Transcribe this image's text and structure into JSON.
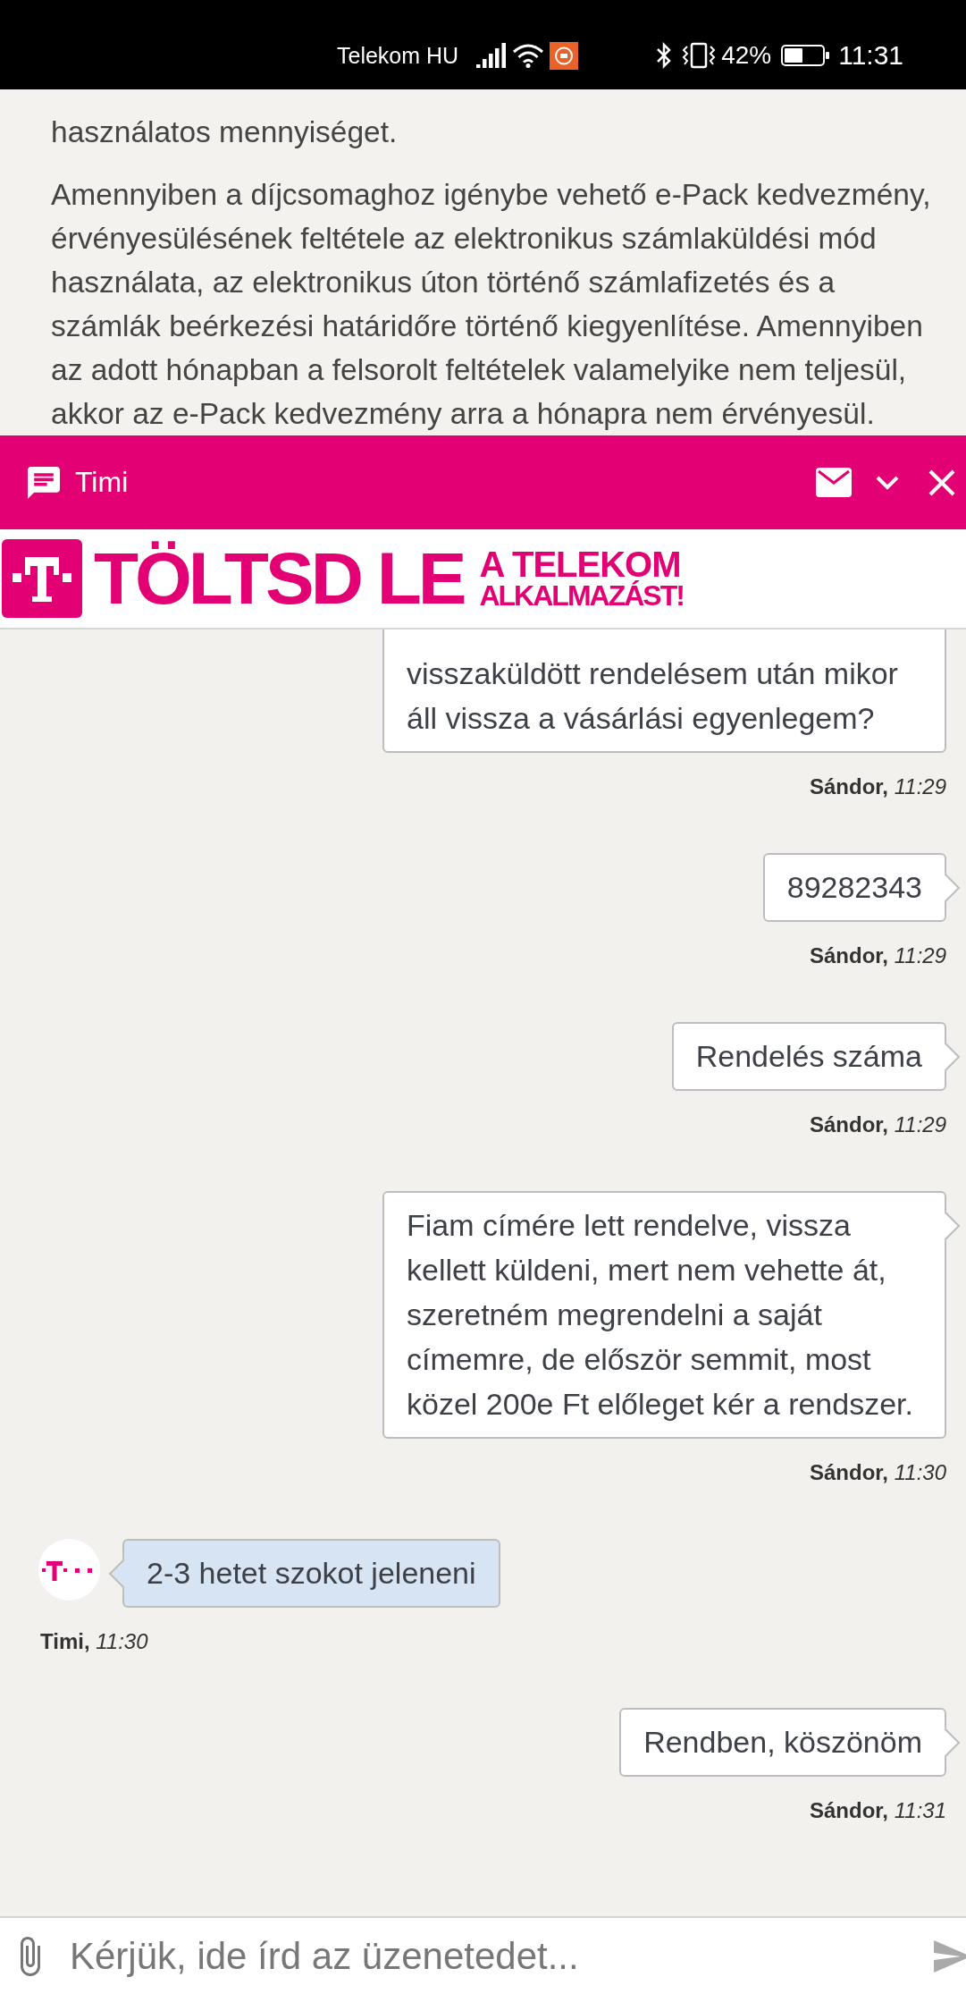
{
  "status_bar": {
    "carrier": "Telekom HU",
    "battery": "42%",
    "time": "11:31"
  },
  "article": {
    "paragraphs": [
      "használatos mennyiséget.",
      "Amennyiben a díjcsomaghoz igénybe vehető e-Pack kedvezmény, érvényesülésének feltétele az elektronikus számlaküldési mód használata, az elektronikus úton történő számlafizetés és a számlák beérkezési határidőre történő kiegyenlítése. Amennyiben az adott hónapban a felsorolt feltételek valamelyike nem teljesül, akkor az e-Pack kedvezmény arra a hónapra nem érvényesül."
    ]
  },
  "chat": {
    "header": {
      "title": "Timi"
    },
    "banner": {
      "headline": "TÖLTSD LE",
      "tagline": [
        "A TELEKOM",
        "ALKALMAZÁST!"
      ]
    },
    "messages": [
      {
        "kind": "sent",
        "text": "visszaküldött rendelésem után mikor áll vissza a vásárlási egyenlegem?",
        "author": "Sándor,",
        "time": "11:29"
      },
      {
        "kind": "sent",
        "text": "89282343",
        "author": "Sándor,",
        "time": "11:29"
      },
      {
        "kind": "sent",
        "text": "Rendelés száma",
        "author": "Sándor,",
        "time": "11:29"
      },
      {
        "kind": "sent",
        "text": "Fiam címére lett rendelve, vissza kellett küldeni, mert nem vehette át, szeretném megrendelni a saját címemre, de először semmit, most közel 200e Ft előleget kér a rendszer.",
        "author": "Sándor,",
        "time": "11:30"
      },
      {
        "kind": "received",
        "text": "2-3 hetet szokot jeleneni",
        "author": "Timi,",
        "time": "11:30"
      },
      {
        "kind": "sent",
        "text": "Rendben, köszönöm",
        "author": "Sándor,",
        "time": "11:31"
      }
    ],
    "input": {
      "placeholder": "Kérjük, ide írd az üzenetedet..."
    }
  }
}
